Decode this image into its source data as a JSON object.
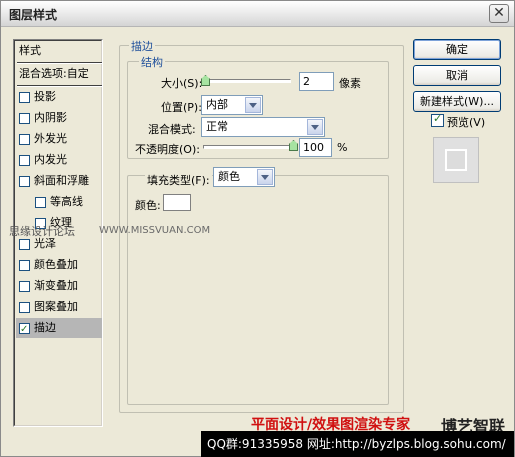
{
  "window": {
    "title": "图层样式",
    "close_glyph": "✕"
  },
  "style_list": {
    "header": "样式",
    "blend_options": "混合选项:自定",
    "items": [
      {
        "label": "投影",
        "checked": false
      },
      {
        "label": "内阴影",
        "checked": false
      },
      {
        "label": "外发光",
        "checked": false
      },
      {
        "label": "内发光",
        "checked": false
      },
      {
        "label": "斜面和浮雕",
        "checked": false
      },
      {
        "label": "等高线",
        "checked": false
      },
      {
        "label": "纹理",
        "checked": false
      },
      {
        "label": "光泽",
        "checked": false
      },
      {
        "label": "颜色叠加",
        "checked": false
      },
      {
        "label": "渐变叠加",
        "checked": false
      },
      {
        "label": "图案叠加",
        "checked": false
      },
      {
        "label": "描边",
        "checked": true
      }
    ]
  },
  "stroke_panel": {
    "group_title": "描边",
    "structure": {
      "title": "结构",
      "size_label": "大小(S):",
      "size_value": "2",
      "size_unit": "像素",
      "position_label": "位置(P):",
      "position_value": "内部",
      "blend_label": "混合模式:",
      "blend_value": "正常",
      "opacity_label": "不透明度(O):",
      "opacity_value": "100",
      "opacity_unit": "%"
    },
    "fill": {
      "fill_type_label": "填充类型(F):",
      "fill_type_value": "颜色",
      "color_label": "颜色:"
    }
  },
  "buttons": {
    "ok": "确定",
    "cancel": "取消",
    "new_style": "新建样式(W)..."
  },
  "preview": {
    "label": "预览(V)",
    "checked": true
  },
  "watermarks": {
    "forum": "思缘设计论坛",
    "site": "WWW.MISSVUAN.COM",
    "slogan": "平面设计/效果图渲染专家",
    "brand": "博艺智联",
    "contact": "QQ群:91335958  网址:http://byzlps.blog.sohu.com/"
  },
  "colors": {
    "accent": "#1e4f9b",
    "selected_bg": "#b6b6b6",
    "dialog_bg": "#ece9d8"
  }
}
